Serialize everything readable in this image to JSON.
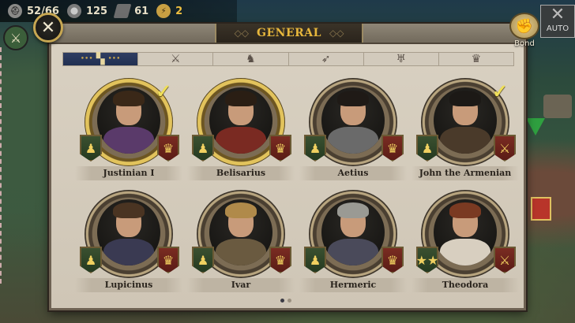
{
  "top_bar": {
    "resources": [
      {
        "icon": "helmet-icon",
        "value": "52/66"
      },
      {
        "icon": "gear-icon",
        "value": "125"
      },
      {
        "icon": "iron-icon",
        "value": "61"
      },
      {
        "icon": "bolt-icon",
        "value": "2"
      }
    ]
  },
  "auto": {
    "label": "AUTO"
  },
  "panel": {
    "title": "GENERAL",
    "bond_label": "Bond",
    "tabs": [
      {
        "name": "tab-all",
        "icon": "grid-icon",
        "active": true
      },
      {
        "name": "tab-infantry",
        "icon": "crossed-swords-icon",
        "active": false
      },
      {
        "name": "tab-cavalry",
        "icon": "horse-icon",
        "active": false
      },
      {
        "name": "tab-archer",
        "icon": "bow-icon",
        "active": false
      },
      {
        "name": "tab-eagle",
        "icon": "eagle-icon",
        "active": false
      },
      {
        "name": "tab-crown",
        "icon": "crown-icon",
        "active": false
      }
    ],
    "generals": [
      {
        "name": "Justinian I",
        "checked": true,
        "gold": true,
        "left_badge": "pawn-icon",
        "right_badge": "crown-icon"
      },
      {
        "name": "Belisarius",
        "checked": false,
        "gold": true,
        "left_badge": "pawn-icon",
        "right_badge": "crown-icon"
      },
      {
        "name": "Aetius",
        "checked": false,
        "gold": false,
        "left_badge": "pawn-icon",
        "right_badge": "crown-icon"
      },
      {
        "name": "John the Armenian",
        "checked": true,
        "gold": false,
        "left_badge": "pawn-icon",
        "right_badge": "crossed-swords-icon"
      },
      {
        "name": "Lupicinus",
        "checked": false,
        "gold": false,
        "left_badge": "pawn-icon",
        "right_badge": "crown-icon"
      },
      {
        "name": "Ivar",
        "checked": false,
        "gold": false,
        "left_badge": "pawn-icon",
        "right_badge": "crown-icon"
      },
      {
        "name": "Hermeric",
        "checked": false,
        "gold": false,
        "left_badge": "pawn-icon",
        "right_badge": "crown-icon"
      },
      {
        "name": "Theodora",
        "checked": false,
        "gold": false,
        "left_badge": "stars-icon",
        "right_badge": "crossed-swords-icon"
      }
    ],
    "pager": {
      "pages": 2,
      "current": 1
    }
  }
}
